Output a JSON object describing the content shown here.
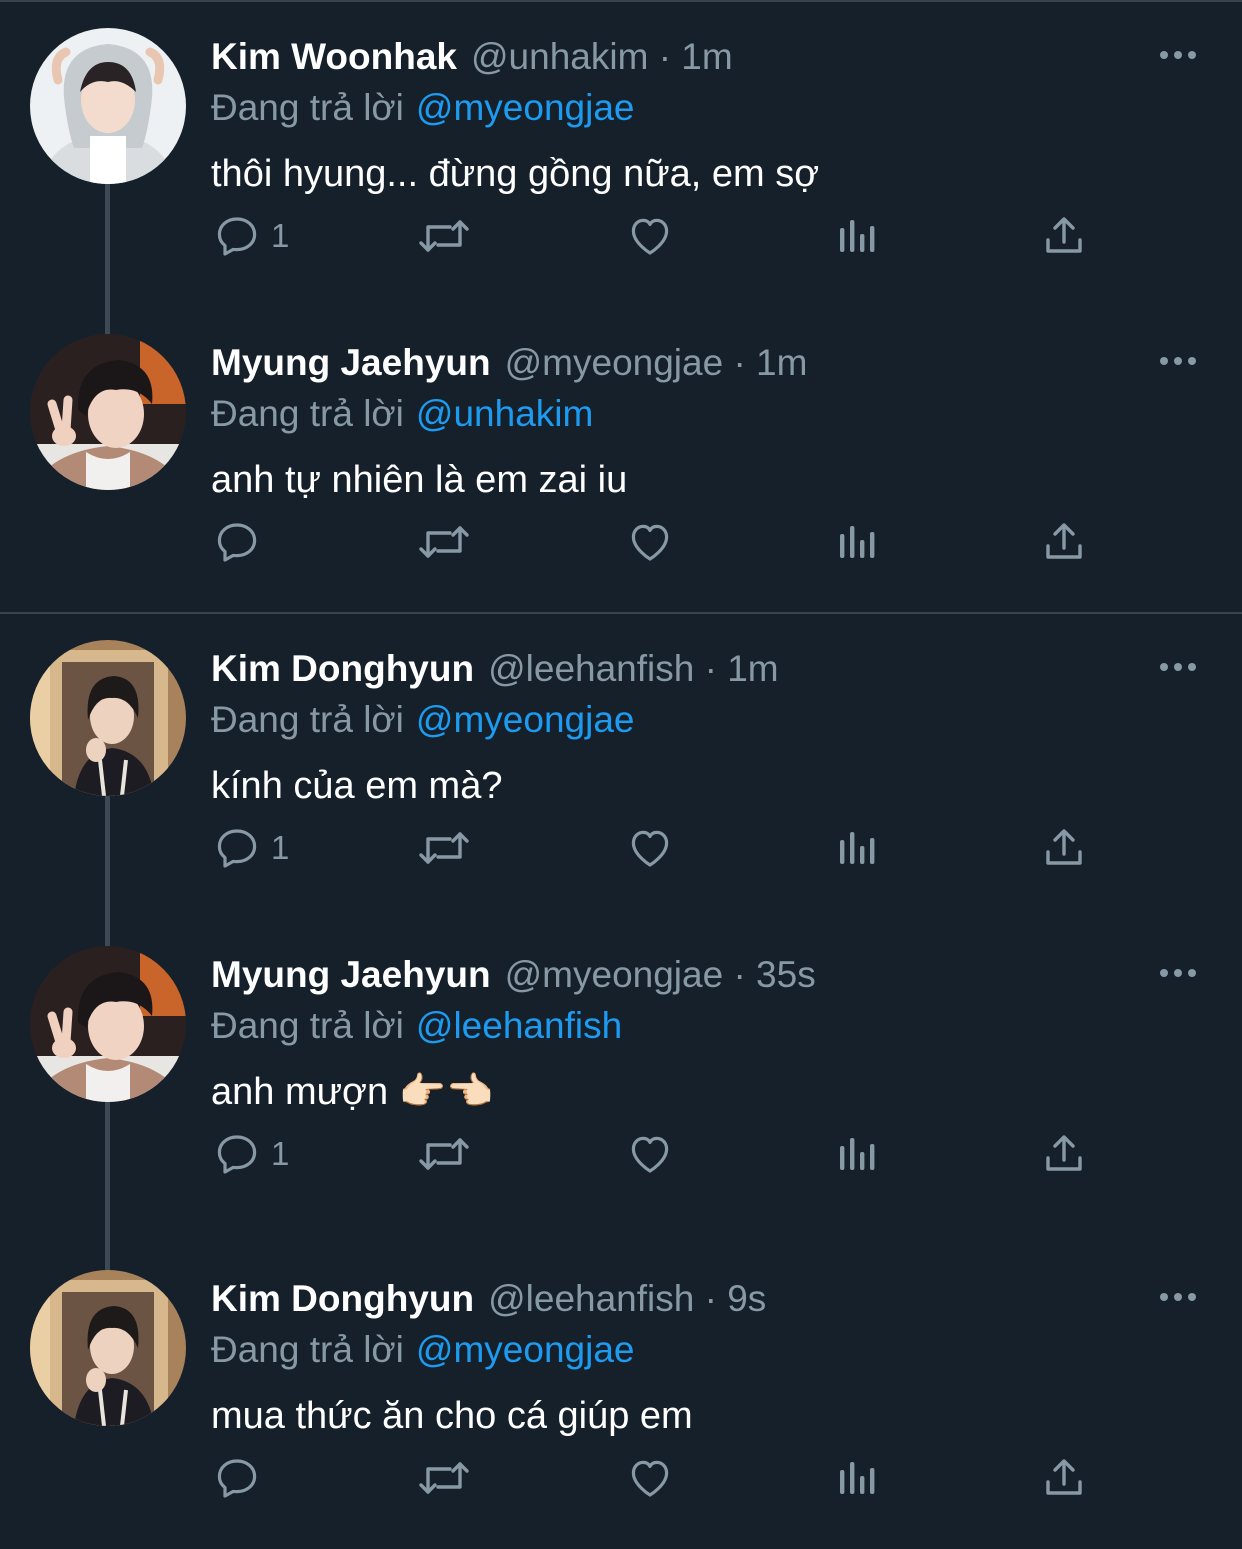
{
  "tweets": [
    {
      "avatar_name": "avatar-kim-woonhak",
      "name": "Kim Woonhak",
      "handle": "@unhakim · 1m",
      "reply_prefix": "Đang trả lời",
      "reply_to": "@myeongjae",
      "text": "thôi hyung... đừng gồng nữa, em sợ",
      "reply_count": "1"
    },
    {
      "avatar_name": "avatar-myung-jaehyun",
      "name": "Myung Jaehyun",
      "handle": "@myeongjae · 1m",
      "reply_prefix": "Đang trả lời",
      "reply_to": "@unhakim",
      "text": "anh tự nhiên là em zai iu",
      "reply_count": ""
    },
    {
      "avatar_name": "avatar-kim-donghyun",
      "name": "Kim Donghyun",
      "handle": "@leehanfish · 1m",
      "reply_prefix": "Đang trả lời",
      "reply_to": "@myeongjae",
      "text": "kính của em mà?",
      "reply_count": "1"
    },
    {
      "avatar_name": "avatar-myung-jaehyun",
      "name": "Myung Jaehyun",
      "handle": "@myeongjae · 35s",
      "reply_prefix": "Đang trả lời",
      "reply_to": "@leehanfish",
      "text": "anh mượn 👉🏻👈🏻",
      "reply_count": "1"
    },
    {
      "avatar_name": "avatar-kim-donghyun",
      "name": "Kim Donghyun",
      "handle": "@leehanfish · 9s",
      "reply_prefix": "Đang trả lời",
      "reply_to": "@myeongjae",
      "text": "mua thức ăn cho cá giúp em",
      "reply_count": ""
    }
  ],
  "icons": {
    "reply": "reply-icon",
    "retweet": "retweet-icon",
    "like": "heart-icon",
    "views": "views-icon",
    "share": "share-icon",
    "more": "more-options-icon"
  },
  "colors": {
    "background": "#15202b",
    "mention": "#1d9bf0",
    "secondary_text": "#8899a6",
    "divider": "#38444d"
  }
}
